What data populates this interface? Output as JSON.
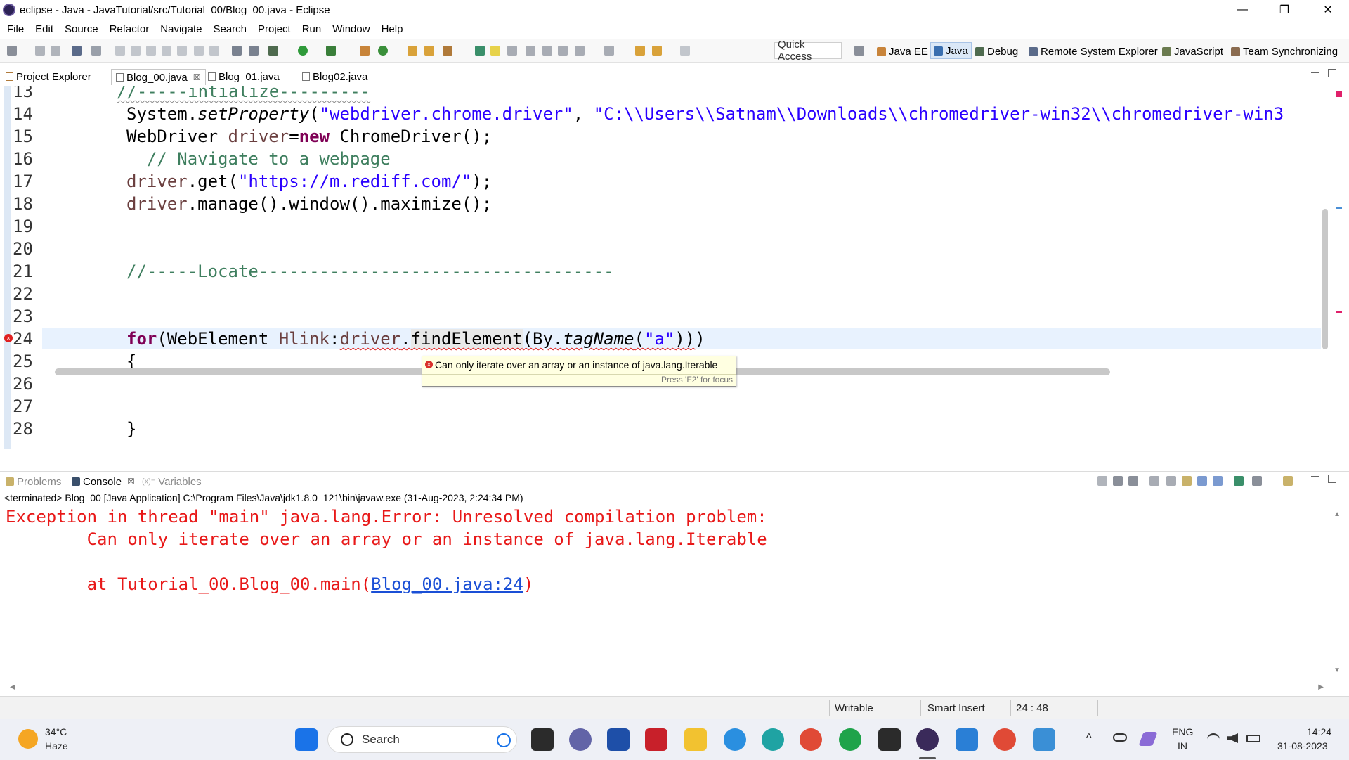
{
  "window": {
    "title": "eclipse - Java - JavaTutorial/src/Tutorial_00/Blog_00.java - Eclipse",
    "minimize": "—",
    "restore": "❐",
    "close": "✕"
  },
  "menu": [
    "File",
    "Edit",
    "Source",
    "Refactor",
    "Navigate",
    "Search",
    "Project",
    "Run",
    "Window",
    "Help"
  ],
  "toolbar": {
    "quick_access": "Quick Access",
    "perspectives": [
      "Java EE",
      "Java",
      "Debug",
      "Remote System Explorer",
      "JavaScript",
      "Team Synchronizing"
    ]
  },
  "editor_tabs": {
    "project_explorer": "Project Explorer",
    "tabs": [
      "Blog_00.java",
      "Blog_01.java",
      "Blog02.java"
    ],
    "close_glyph": "☒"
  },
  "editor": {
    "line_numbers": [
      "13",
      "14",
      "15",
      "16",
      "17",
      "18",
      "19",
      "20",
      "21",
      "22",
      "23",
      "24",
      "25",
      "26",
      "27",
      "28"
    ],
    "code": {
      "l13": "//-----intialize---------",
      "l14_a": "System.",
      "l14_b": "setProperty",
      "l14_c": "(",
      "l14_d": "\"webdriver.chrome.driver\"",
      "l14_e": ", ",
      "l14_f": "\"C:\\\\Users\\\\Satnam\\\\Downloads\\\\chromedriver-win32\\\\chromedriver-win3",
      "l15_a": "WebDriver ",
      "l15_b": "driver",
      "l15_c": "=",
      "l15_d": "new",
      "l15_e": " ChromeDriver();",
      "l16": "  // Navigate to a webpage",
      "l17_a": "driver",
      "l17_b": ".get(",
      "l17_c": "\"https://m.rediff.com/\"",
      "l17_d": ");",
      "l18_a": "driver",
      "l18_b": ".manage().window().maximize();",
      "l21": "//-----Locate-----------------------------------",
      "l24_a": "for",
      "l24_b": "(WebElement ",
      "l24_c": "Hlink",
      "l24_d": ":",
      "l24_e": "driver",
      "l24_f": ".",
      "l24_g": "findElement",
      "l24_h": "(By.",
      "l24_i": "tagName",
      "l24_j": "(",
      "l24_k": "\"a\"",
      "l24_l": "))",
      "l25": "{",
      "l28": "}"
    },
    "error_marker": "×"
  },
  "tooltip": {
    "message": "Can only iterate over an array or an instance of java.lang.Iterable",
    "hint": "Press 'F2' for focus",
    "icon": "×"
  },
  "panel": {
    "tabs": [
      "Problems",
      "Console",
      "Variables"
    ],
    "close_glyph": "☒",
    "var_prefix": "(x)=",
    "console_info": "<terminated> Blog_00 [Java Application] C:\\Program Files\\Java\\jdk1.8.0_121\\bin\\javaw.exe (31-Aug-2023, 2:24:34 PM)",
    "output": {
      "line1": "Exception in thread \"main\" java.lang.Error: Unresolved compilation problem: ",
      "line2": "        Can only iterate over an array or an instance of java.lang.Iterable",
      "line3_a": "        at Tutorial_00.Blog_00.main(",
      "line3_link": "Blog_00.java:24",
      "line3_b": ")"
    }
  },
  "status": {
    "writable": "Writable",
    "insert_mode": "Smart Insert",
    "position": "24 : 48"
  },
  "taskbar": {
    "temperature": "34°C",
    "condition": "Haze",
    "search_placeholder": "Search",
    "lang_top": "ENG",
    "lang_bottom": "IN",
    "time": "14:24",
    "date": "31-08-2023",
    "chevron": "^"
  },
  "colors": {
    "keyword": "#7f0055",
    "string": "#2a00ff",
    "comment": "#3f7f5f",
    "console_error": "#e81818",
    "link": "#1a4fd6",
    "tooltip_bg": "#ffffe1"
  }
}
